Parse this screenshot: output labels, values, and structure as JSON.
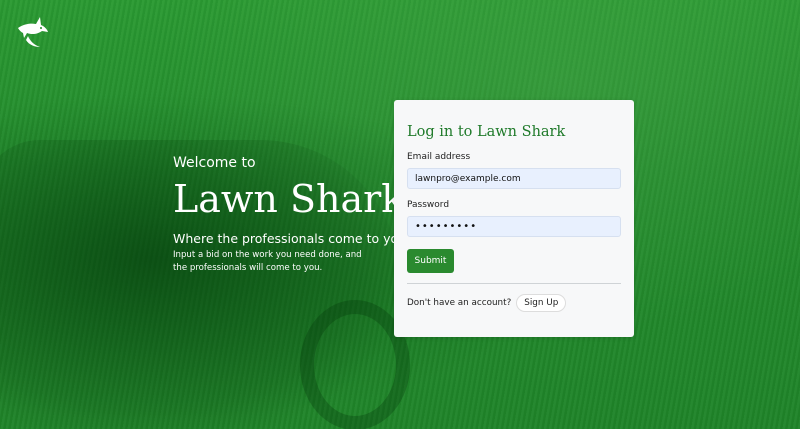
{
  "hero": {
    "welcome": "Welcome to",
    "brand": "Lawn Shark",
    "tagline": "Where the professionals come to you!",
    "description": "Input a bid on the work you need done, and the professionals will come to you."
  },
  "login": {
    "title": "Log in to Lawn Shark",
    "email_label": "Email address",
    "email_value": "lawnpro@example.com",
    "password_label": "Password",
    "password_value": "•••••••••",
    "submit_label": "Submit",
    "signup_prompt": "Don't have an account?",
    "signup_label": "Sign Up"
  },
  "colors": {
    "brand_green": "#2a8a2f",
    "title_green": "#1f7a2a",
    "card_bg": "#f7f8f9",
    "input_bg": "#e8f0fe"
  },
  "icons": {
    "logo": "shark-logo-icon"
  }
}
